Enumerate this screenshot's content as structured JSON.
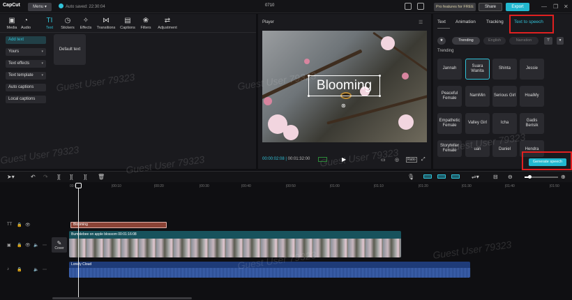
{
  "titlebar": {
    "logo": "CapCut",
    "menu_label": "Menu",
    "autosave": "Auto saved: 22:30:04",
    "project_title": "0710",
    "pro_label": "Pro features for FREE",
    "share_label": "Share",
    "export_label": "Export"
  },
  "toolbar": {
    "tools": [
      {
        "label": "Media",
        "icon": "▣"
      },
      {
        "label": "Audio",
        "icon": "◔"
      },
      {
        "label": "Text",
        "icon": "TI"
      },
      {
        "label": "Stickers",
        "icon": "◷"
      },
      {
        "label": "Effects",
        "icon": "✧"
      },
      {
        "label": "Transitions",
        "icon": "⋈"
      },
      {
        "label": "Captions",
        "icon": "▤"
      },
      {
        "label": "Filters",
        "icon": "❀"
      },
      {
        "label": "Adjustment",
        "icon": "⇄"
      }
    ],
    "active": "Text"
  },
  "left_menu": {
    "items": [
      "Add text",
      "Yours",
      "Text effects",
      "Text template",
      "Auto captions",
      "Local captions"
    ]
  },
  "template_tile": "Default text",
  "watermark": "Guest User 79323",
  "player": {
    "title": "Player",
    "caption_text": "Blooming",
    "time_current": "00:00:02:08",
    "time_total": "00:01:32:00",
    "ratio_label": "Ratio"
  },
  "right_panel": {
    "tabs": [
      "Text",
      "Animation",
      "Tracking",
      "Text to speech"
    ],
    "active_tab": "Text to speech",
    "filters": [
      "Trending",
      "English",
      "Narration"
    ],
    "section_label": "Trending",
    "voices": [
      [
        "Jannah",
        "Suara Wanita",
        "Shinta",
        "Jessie"
      ],
      [
        "Peaceful Female",
        "NamMin",
        "Serious Girl",
        "HoaiMy"
      ],
      [
        "Empathetic Female",
        "Valley Girl",
        "Icha",
        "Gadis Berisik"
      ],
      [
        "Storyteller Female",
        "uan",
        "Daniel",
        "Hendra"
      ]
    ],
    "selected_voice": "Suara Wanita",
    "generate_label": "Generate speech"
  },
  "timeline": {
    "ruler_ticks": [
      "00:00",
      "|00:10",
      "|00:20",
      "|00:30",
      "|00:40",
      "|00:50",
      "|01:00",
      "|01:10",
      "|01:20",
      "|01:30",
      "|01:40",
      "|01:50"
    ],
    "text_clip": "Blooming",
    "video_clip": "Bumblebee on apple blossom  00:01:16:08",
    "cover_label": "Cover",
    "audio_clip": "Lonely Cloud"
  },
  "colors": {
    "accent": "#22b8cf",
    "highlight_box": "#e02020",
    "text_clip": "#8a4336",
    "video_clip": "#17525c",
    "audio_clip": "#1e3b78"
  }
}
